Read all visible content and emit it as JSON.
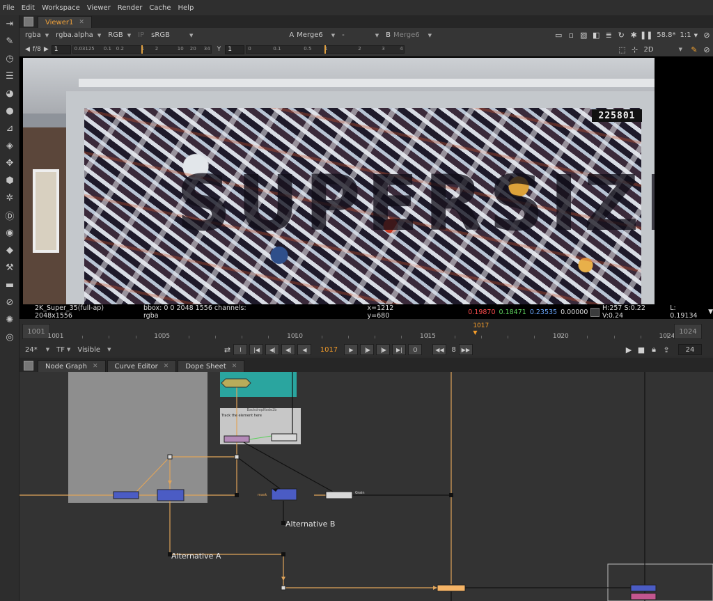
{
  "menu": [
    "File",
    "Edit",
    "Workspace",
    "Viewer",
    "Render",
    "Cache",
    "Help"
  ],
  "toolbar_icons": [
    "viewer-panel-icon",
    "paint-brush-icon",
    "clock-icon",
    "channel-icon",
    "color-wheel-icon",
    "filter-icon",
    "keyer-icon",
    "layers-icon",
    "transform-icon",
    "cube-icon",
    "particle-icon",
    "deep-icon",
    "views-icon",
    "tags-icon",
    "toolsets-icon",
    "other-icon",
    "furnace-icon",
    "settings-icon",
    "ocula-icon"
  ],
  "viewer_tab": {
    "label": "Viewer1",
    "close": "✕"
  },
  "viewer_controls": {
    "channels": "rgba",
    "layer": "rgba.alpha",
    "display": "RGB",
    "ip": "IP",
    "colorspace": "sRGB",
    "a_label": "A",
    "a_input": "Merge6",
    "wipe": "-",
    "b_label": "B",
    "b_input": "Merge6",
    "zoom": "58.8*",
    "ratio": "1:1"
  },
  "viewer_controls2": {
    "fstop": "f/8",
    "gain": "1",
    "gain_ruler": [
      "0.03125",
      "0.1",
      "0.2",
      "1",
      "2",
      "10",
      "20",
      "34"
    ],
    "gamma_label": "Y",
    "gamma": "1",
    "gamma_ruler": [
      "0",
      "0.1",
      "0.5",
      "1",
      "2",
      "3",
      "4"
    ],
    "view_mode": "2D"
  },
  "image": {
    "number_plate": "225801",
    "letters": "SUPERSIZE"
  },
  "info_bar": {
    "format": "2K_Super_35(full-ap) 2048x1556",
    "bbox": "bbox: 0 0 2048 1556 channels: rgba",
    "coords": "x=1212 y=680",
    "r": "0.19870",
    "g": "0.18471",
    "b": "0.23535",
    "a": "0.00000",
    "hsv": "H:257 S:0.22 V:0.24",
    "lum": "L: 0.19134",
    "colors": {
      "r": "#ff4d4d",
      "g": "#5ed35e",
      "b": "#6aa8ff"
    }
  },
  "timeline": {
    "start": "1001",
    "end": "1024",
    "current": "1017",
    "labels": [
      "1001",
      "1005",
      "1010",
      "1015",
      "1020",
      "1024"
    ],
    "first_frame": 1001,
    "last_frame": 1024
  },
  "transport": {
    "fps": "24*",
    "tf": "TF",
    "visible": "Visible",
    "frame": "1017",
    "increment": "8",
    "end_frame": "24"
  },
  "graph_tabs": [
    {
      "label": "Node Graph",
      "close": "✕"
    },
    {
      "label": "Curve Editor",
      "close": "✕"
    },
    {
      "label": "Dope Sheet",
      "close": "✕"
    }
  ],
  "graph": {
    "backdrop_title": "BackdropNode2b",
    "backdrop_note": "Track the element here",
    "alt_a": "Alternative A",
    "alt_b": "Alternative B",
    "mask_label": "mask",
    "grain_label": "Grain",
    "pipe_color": "#e0a45a"
  }
}
